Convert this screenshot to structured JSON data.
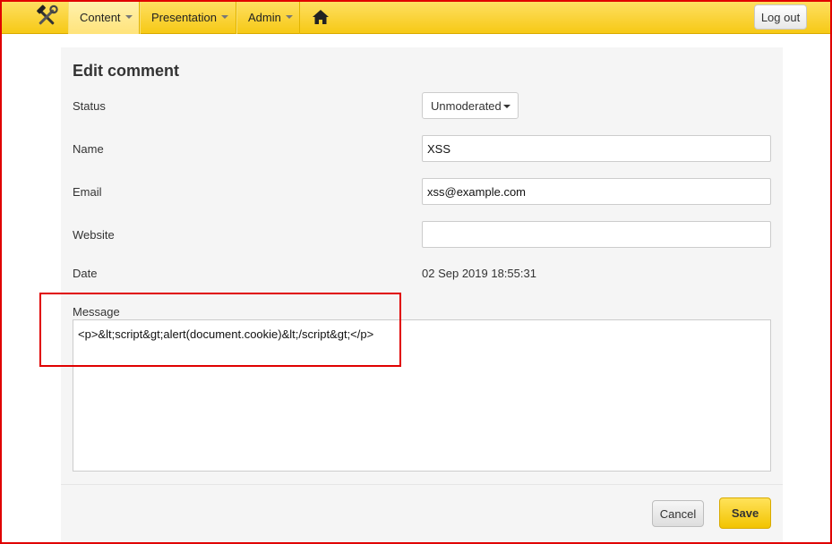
{
  "nav": {
    "logo_icon": "tools-icon",
    "items": [
      {
        "label": "Content",
        "active": true
      },
      {
        "label": "Presentation",
        "active": false
      },
      {
        "label": "Admin",
        "active": false
      }
    ],
    "home_icon": "home-icon",
    "logout_label": "Log out"
  },
  "form": {
    "title": "Edit comment",
    "status": {
      "label": "Status",
      "value": "Unmoderated"
    },
    "name": {
      "label": "Name",
      "value": "XSS"
    },
    "email": {
      "label": "Email",
      "value": "xss@example.com"
    },
    "website": {
      "label": "Website",
      "value": ""
    },
    "date": {
      "label": "Date",
      "value": "02 Sep 2019 18:55:31"
    },
    "message": {
      "label": "Message",
      "value": "<p>&lt;script&gt;alert(document.cookie)&lt;/script&gt;</p>"
    }
  },
  "actions": {
    "cancel_label": "Cancel",
    "save_label": "Save"
  },
  "colors": {
    "nav_bar": "#f6c915",
    "highlight_border": "#e00000",
    "save_button": "#f2c400"
  }
}
